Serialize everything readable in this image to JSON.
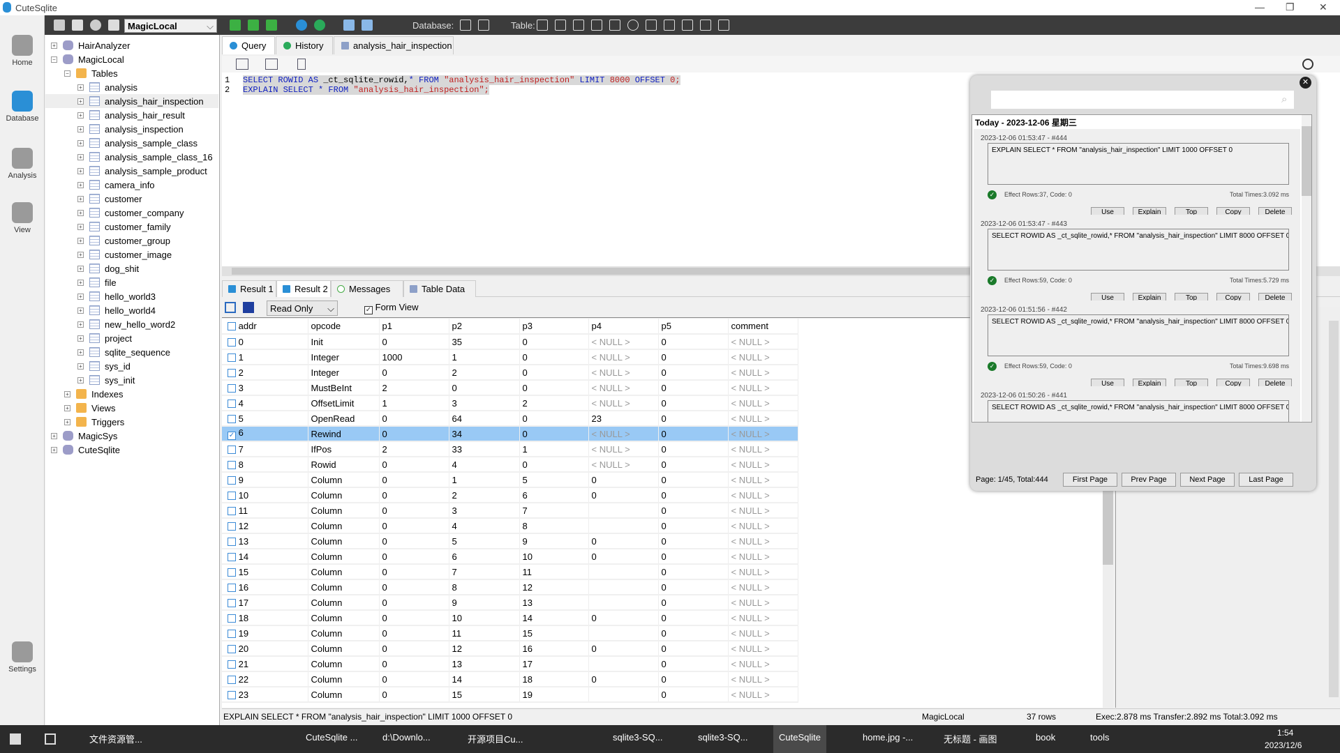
{
  "app": {
    "title": "CuteSqlite",
    "selected_db": "MagicLocal",
    "database_label": "Database:",
    "table_label": "Table:"
  },
  "rail": [
    {
      "label": "Home",
      "icon": "home-icon"
    },
    {
      "label": "Database",
      "icon": "database-icon"
    },
    {
      "label": "Analysis",
      "icon": "microscope-icon"
    },
    {
      "label": "View",
      "icon": "view-icon"
    },
    {
      "label": "Settings",
      "icon": "gear-icon"
    }
  ],
  "tree": {
    "dbs_top": [
      "HairAnalyzer",
      "MagicLocal"
    ],
    "tables_label": "Tables",
    "tables": [
      "analysis",
      "analysis_hair_inspection",
      "analysis_hair_result",
      "analysis_inspection",
      "analysis_sample_class",
      "analysis_sample_class_16",
      "analysis_sample_product",
      "camera_info",
      "customer",
      "customer_company",
      "customer_family",
      "customer_group",
      "customer_image",
      "dog_shit",
      "file",
      "hello_world3",
      "hello_world4",
      "new_hello_word2",
      "project",
      "sqlite_sequence",
      "sys_id",
      "sys_init"
    ],
    "folders": [
      "Indexes",
      "Views",
      "Triggers"
    ],
    "dbs_bottom": [
      "MagicSys",
      "CuteSqlite"
    ]
  },
  "tabs": [
    "Query",
    "History",
    "analysis_hair_inspection"
  ],
  "editor": {
    "line1": [
      "SELECT ROWID AS ",
      "_ct_sqlite_rowid,",
      "* FROM ",
      "\"analysis_hair_inspection\"",
      "LIMIT ",
      "8000",
      " OFFSET ",
      "0;"
    ],
    "line2": [
      "EXPLAIN SELECT ",
      "* FROM ",
      "\"analysis_hair_inspection\";"
    ]
  },
  "result_tabs": [
    "Result 1",
    "Result 2",
    "Messages",
    "Table Data"
  ],
  "result_toolbar": {
    "mode": "Read Only",
    "form_view": "Form View"
  },
  "grid": {
    "columns": [
      "addr",
      "opcode",
      "p1",
      "p2",
      "p3",
      "p4",
      "p5",
      "comment"
    ],
    "selected_row": 6,
    "rows": [
      [
        "0",
        "Init",
        "0",
        "35",
        "0",
        null,
        "0",
        null
      ],
      [
        "1",
        "Integer",
        "1000",
        "1",
        "0",
        null,
        "0",
        null
      ],
      [
        "2",
        "Integer",
        "0",
        "2",
        "0",
        null,
        "0",
        null
      ],
      [
        "3",
        "MustBeInt",
        "2",
        "0",
        "0",
        null,
        "0",
        null
      ],
      [
        "4",
        "OffsetLimit",
        "1",
        "3",
        "2",
        null,
        "0",
        null
      ],
      [
        "5",
        "OpenRead",
        "0",
        "64",
        "0",
        "23",
        "0",
        null
      ],
      [
        "6",
        "Rewind",
        "0",
        "34",
        "0",
        null,
        "0",
        null
      ],
      [
        "7",
        "IfPos",
        "2",
        "33",
        "1",
        null,
        "0",
        null
      ],
      [
        "8",
        "Rowid",
        "0",
        "4",
        "0",
        null,
        "0",
        null
      ],
      [
        "9",
        "Column",
        "0",
        "1",
        "5",
        "0",
        "0",
        null
      ],
      [
        "10",
        "Column",
        "0",
        "2",
        "6",
        "0",
        "0",
        null
      ],
      [
        "11",
        "Column",
        "0",
        "3",
        "7",
        "",
        "0",
        null
      ],
      [
        "12",
        "Column",
        "0",
        "4",
        "8",
        "",
        "0",
        null
      ],
      [
        "13",
        "Column",
        "0",
        "5",
        "9",
        "0",
        "0",
        null
      ],
      [
        "14",
        "Column",
        "0",
        "6",
        "10",
        "0",
        "0",
        null
      ],
      [
        "15",
        "Column",
        "0",
        "7",
        "11",
        "",
        "0",
        null
      ],
      [
        "16",
        "Column",
        "0",
        "8",
        "12",
        "",
        "0",
        null
      ],
      [
        "17",
        "Column",
        "0",
        "9",
        "13",
        "",
        "0",
        null
      ],
      [
        "18",
        "Column",
        "0",
        "10",
        "14",
        "0",
        "0",
        null
      ],
      [
        "19",
        "Column",
        "0",
        "11",
        "15",
        "",
        "0",
        null
      ],
      [
        "20",
        "Column",
        "0",
        "12",
        "16",
        "0",
        "0",
        null
      ],
      [
        "21",
        "Column",
        "0",
        "13",
        "17",
        "",
        "0",
        null
      ],
      [
        "22",
        "Column",
        "0",
        "14",
        "18",
        "0",
        "0",
        null
      ],
      [
        "23",
        "Column",
        "0",
        "15",
        "19",
        "",
        "0",
        null
      ]
    ],
    "null_text": "< NULL >"
  },
  "status": {
    "sql": "EXPLAIN SELECT * FROM \"analysis_hair_inspection\" LIMIT 1000 OFFSET 0",
    "db": "MagicLocal",
    "rows": "37 rows",
    "timing": "Exec:2.878 ms Transfer:2.892 ms Total:3.092 ms"
  },
  "history": {
    "search_placeholder": "",
    "day": "Today - 2023-12-06 星期三",
    "items": [
      {
        "ts": "2023-12-06 01:53:47 - #444",
        "sql": "EXPLAIN SELECT * FROM \"analysis_hair_inspection\" LIMIT 1000 OFFSET 0",
        "effect": "Effect Rows:37, Code: 0",
        "time": "Total Times:3.092 ms"
      },
      {
        "ts": "2023-12-06 01:53:47 - #443",
        "sql": "SELECT ROWID AS _ct_sqlite_rowid,* FROM \"analysis_hair_inspection\" LIMIT 8000 OFFSET 0",
        "effect": "Effect Rows:59, Code: 0",
        "time": "Total Times:5.729 ms"
      },
      {
        "ts": "2023-12-06 01:51:56 - #442",
        "sql": "SELECT ROWID AS _ct_sqlite_rowid,* FROM \"analysis_hair_inspection\" LIMIT 8000 OFFSET 0",
        "effect": "Effect Rows:59, Code: 0",
        "time": "Total Times:9.698 ms"
      },
      {
        "ts": "2023-12-06 01:50:26 - #441",
        "sql": "SELECT ROWID AS _ct_sqlite_rowid,* FROM \"analysis_hair_inspection\" LIMIT 8000 OFFSET 0",
        "effect": "",
        "time": ""
      }
    ],
    "item_buttons": [
      "Use",
      "Explain",
      "Top",
      "Copy",
      "Delete"
    ],
    "page_info": "Page: 1/45, Total:444",
    "page_buttons": [
      "First Page",
      "Prev Page",
      "Next Page",
      "Last Page"
    ]
  },
  "taskbar": {
    "items": [
      "文件资源管...",
      "CuteSqlite ...",
      "d:\\Downlo...",
      "开源项目Cu...",
      "sqlite3-SQ...",
      "sqlite3-SQ...",
      "CuteSqlite",
      "home.jpg -...",
      "无标题 - 画图",
      "book",
      "tools"
    ],
    "active": 6,
    "clock_time": "1:54",
    "clock_date": "2023/12/6"
  },
  "colors": {
    "accent": "#2a8fd6",
    "selection": "#99c9f5",
    "toolbar": "#3c3c3c",
    "success": "#1a7a2a"
  }
}
